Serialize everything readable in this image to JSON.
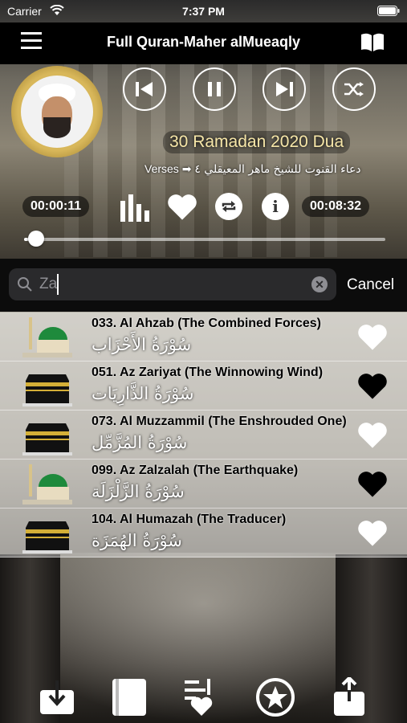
{
  "status": {
    "carrier": "Carrier",
    "time": "7:37 PM"
  },
  "nav": {
    "title": "Full Quran-Maher alMueaqly"
  },
  "player": {
    "track_title": "30 Ramadan 2020 Dua",
    "subtitle_arabic": "دعاء القنوت للشيخ ماهر المعيقلي ٤",
    "subtitle_verses": "Verses ➡",
    "elapsed": "00:00:11",
    "duration": "00:08:32",
    "progress": 0.01
  },
  "search": {
    "value": "Za",
    "cancel_label": "Cancel"
  },
  "surahs": [
    {
      "title": "033. Al Ahzab (The Combined Forces)",
      "arabic": "سُوْرَةُ الأَحْزَاب",
      "thumb": "madinah",
      "favorite": false
    },
    {
      "title": "051. Az Zariyat (The Winnowing Wind)",
      "arabic": "سُوْرَةُ الذَّارِيَات",
      "thumb": "kaaba",
      "favorite": true
    },
    {
      "title": "073. Al Muzzammil (The Enshrouded One)",
      "arabic": "سُوْرَةُ المُزَّمِّل",
      "thumb": "kaaba",
      "favorite": false
    },
    {
      "title": "099. Az Zalzalah (The Earthquake)",
      "arabic": "سُوْرَةُ الزَّلْزَلَة",
      "thumb": "madinah",
      "favorite": true
    },
    {
      "title": "104. Al Humazah (The Traducer)",
      "arabic": "سُوْرَةُ الهُمَزَة",
      "thumb": "kaaba",
      "favorite": false
    }
  ],
  "tabbar": [
    "download-icon",
    "quran-book-icon",
    "playlist-heart-icon",
    "star-icon",
    "share-icon"
  ]
}
